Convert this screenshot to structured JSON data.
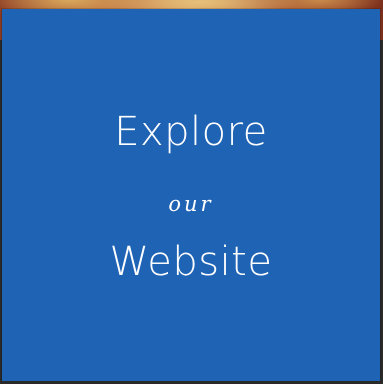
{
  "cta": {
    "line1": "Explore",
    "line2": "our",
    "line3": "Website",
    "panel_color": "#1f63b5",
    "text_color": "#ffffff"
  },
  "background": {
    "type": "photo",
    "description_tone": "warm"
  }
}
